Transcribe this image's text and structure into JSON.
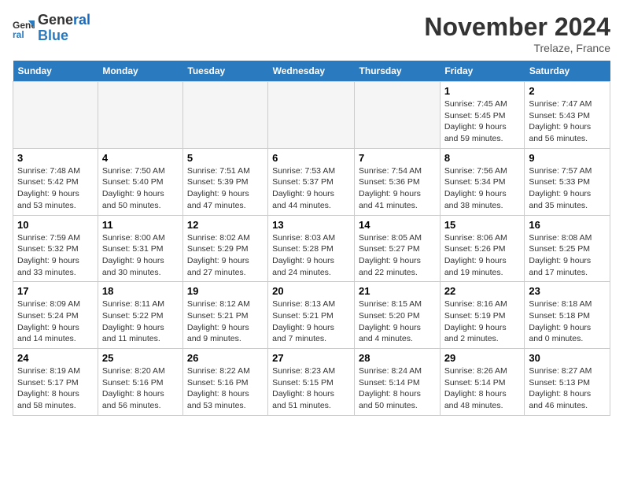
{
  "logo": {
    "line1": "General",
    "line2": "Blue"
  },
  "title": "November 2024",
  "location": "Trelaze, France",
  "days_header": [
    "Sunday",
    "Monday",
    "Tuesday",
    "Wednesday",
    "Thursday",
    "Friday",
    "Saturday"
  ],
  "weeks": [
    [
      {
        "day": "",
        "info": ""
      },
      {
        "day": "",
        "info": ""
      },
      {
        "day": "",
        "info": ""
      },
      {
        "day": "",
        "info": ""
      },
      {
        "day": "",
        "info": ""
      },
      {
        "day": "1",
        "info": "Sunrise: 7:45 AM\nSunset: 5:45 PM\nDaylight: 9 hours and 59 minutes."
      },
      {
        "day": "2",
        "info": "Sunrise: 7:47 AM\nSunset: 5:43 PM\nDaylight: 9 hours and 56 minutes."
      }
    ],
    [
      {
        "day": "3",
        "info": "Sunrise: 7:48 AM\nSunset: 5:42 PM\nDaylight: 9 hours and 53 minutes."
      },
      {
        "day": "4",
        "info": "Sunrise: 7:50 AM\nSunset: 5:40 PM\nDaylight: 9 hours and 50 minutes."
      },
      {
        "day": "5",
        "info": "Sunrise: 7:51 AM\nSunset: 5:39 PM\nDaylight: 9 hours and 47 minutes."
      },
      {
        "day": "6",
        "info": "Sunrise: 7:53 AM\nSunset: 5:37 PM\nDaylight: 9 hours and 44 minutes."
      },
      {
        "day": "7",
        "info": "Sunrise: 7:54 AM\nSunset: 5:36 PM\nDaylight: 9 hours and 41 minutes."
      },
      {
        "day": "8",
        "info": "Sunrise: 7:56 AM\nSunset: 5:34 PM\nDaylight: 9 hours and 38 minutes."
      },
      {
        "day": "9",
        "info": "Sunrise: 7:57 AM\nSunset: 5:33 PM\nDaylight: 9 hours and 35 minutes."
      }
    ],
    [
      {
        "day": "10",
        "info": "Sunrise: 7:59 AM\nSunset: 5:32 PM\nDaylight: 9 hours and 33 minutes."
      },
      {
        "day": "11",
        "info": "Sunrise: 8:00 AM\nSunset: 5:31 PM\nDaylight: 9 hours and 30 minutes."
      },
      {
        "day": "12",
        "info": "Sunrise: 8:02 AM\nSunset: 5:29 PM\nDaylight: 9 hours and 27 minutes."
      },
      {
        "day": "13",
        "info": "Sunrise: 8:03 AM\nSunset: 5:28 PM\nDaylight: 9 hours and 24 minutes."
      },
      {
        "day": "14",
        "info": "Sunrise: 8:05 AM\nSunset: 5:27 PM\nDaylight: 9 hours and 22 minutes."
      },
      {
        "day": "15",
        "info": "Sunrise: 8:06 AM\nSunset: 5:26 PM\nDaylight: 9 hours and 19 minutes."
      },
      {
        "day": "16",
        "info": "Sunrise: 8:08 AM\nSunset: 5:25 PM\nDaylight: 9 hours and 17 minutes."
      }
    ],
    [
      {
        "day": "17",
        "info": "Sunrise: 8:09 AM\nSunset: 5:24 PM\nDaylight: 9 hours and 14 minutes."
      },
      {
        "day": "18",
        "info": "Sunrise: 8:11 AM\nSunset: 5:22 PM\nDaylight: 9 hours and 11 minutes."
      },
      {
        "day": "19",
        "info": "Sunrise: 8:12 AM\nSunset: 5:21 PM\nDaylight: 9 hours and 9 minutes."
      },
      {
        "day": "20",
        "info": "Sunrise: 8:13 AM\nSunset: 5:21 PM\nDaylight: 9 hours and 7 minutes."
      },
      {
        "day": "21",
        "info": "Sunrise: 8:15 AM\nSunset: 5:20 PM\nDaylight: 9 hours and 4 minutes."
      },
      {
        "day": "22",
        "info": "Sunrise: 8:16 AM\nSunset: 5:19 PM\nDaylight: 9 hours and 2 minutes."
      },
      {
        "day": "23",
        "info": "Sunrise: 8:18 AM\nSunset: 5:18 PM\nDaylight: 9 hours and 0 minutes."
      }
    ],
    [
      {
        "day": "24",
        "info": "Sunrise: 8:19 AM\nSunset: 5:17 PM\nDaylight: 8 hours and 58 minutes."
      },
      {
        "day": "25",
        "info": "Sunrise: 8:20 AM\nSunset: 5:16 PM\nDaylight: 8 hours and 56 minutes."
      },
      {
        "day": "26",
        "info": "Sunrise: 8:22 AM\nSunset: 5:16 PM\nDaylight: 8 hours and 53 minutes."
      },
      {
        "day": "27",
        "info": "Sunrise: 8:23 AM\nSunset: 5:15 PM\nDaylight: 8 hours and 51 minutes."
      },
      {
        "day": "28",
        "info": "Sunrise: 8:24 AM\nSunset: 5:14 PM\nDaylight: 8 hours and 50 minutes."
      },
      {
        "day": "29",
        "info": "Sunrise: 8:26 AM\nSunset: 5:14 PM\nDaylight: 8 hours and 48 minutes."
      },
      {
        "day": "30",
        "info": "Sunrise: 8:27 AM\nSunset: 5:13 PM\nDaylight: 8 hours and 46 minutes."
      }
    ]
  ]
}
